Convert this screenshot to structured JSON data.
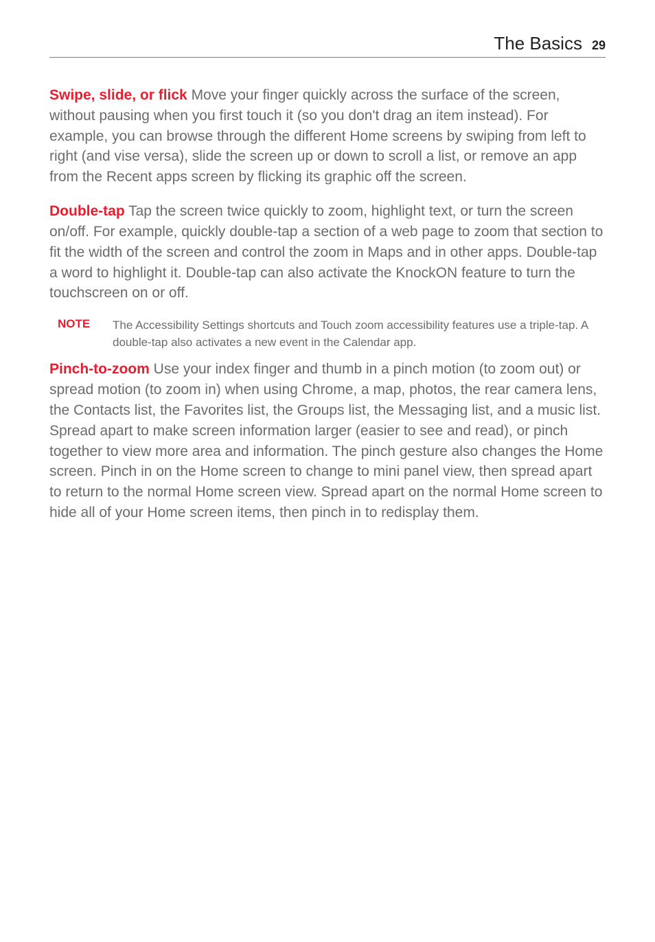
{
  "header": {
    "section_title": "The Basics",
    "page_number": "29"
  },
  "paragraphs": {
    "swipe": {
      "term": "Swipe, slide, or flick",
      "body": " Move your finger quickly across the surface of the screen, without pausing when you first touch it (so you don't drag an item instead). For example, you can browse through the different Home screens by swiping from left to right (and vise versa), slide the screen up or down to scroll a list, or remove an app from the Recent apps screen by flicking its graphic off the screen."
    },
    "doubletap": {
      "term": "Double-tap",
      "body": " Tap the screen twice quickly to zoom, highlight text, or turn the screen on/off. For example, quickly double-tap a section of a web page to zoom that section to fit the width of the screen and control the zoom in Maps and in other apps. Double-tap a word to highlight it. Double-tap can also activate the KnockON feature to turn the touchscreen on or off."
    },
    "pinch": {
      "term": "Pinch-to-zoom",
      "body": " Use your index finger and thumb in a pinch motion (to zoom out) or spread motion (to zoom in) when using Chrome, a map, photos, the rear camera lens, the Contacts list, the Favorites list, the Groups list, the Messaging list, and a music list. Spread apart to make screen information larger (easier to see and read), or pinch together to view more area and information. The pinch gesture also changes the Home screen. Pinch in on the Home screen to change to mini panel view, then spread apart to return to the normal Home screen view. Spread apart on the normal Home screen to hide all of your Home screen items, then pinch in to redisplay them."
    }
  },
  "note": {
    "label": "NOTE",
    "text": "The Accessibility Settings shortcuts and Touch zoom accessibility features use a triple-tap. A double-tap also activates a new event in the Calendar app."
  }
}
